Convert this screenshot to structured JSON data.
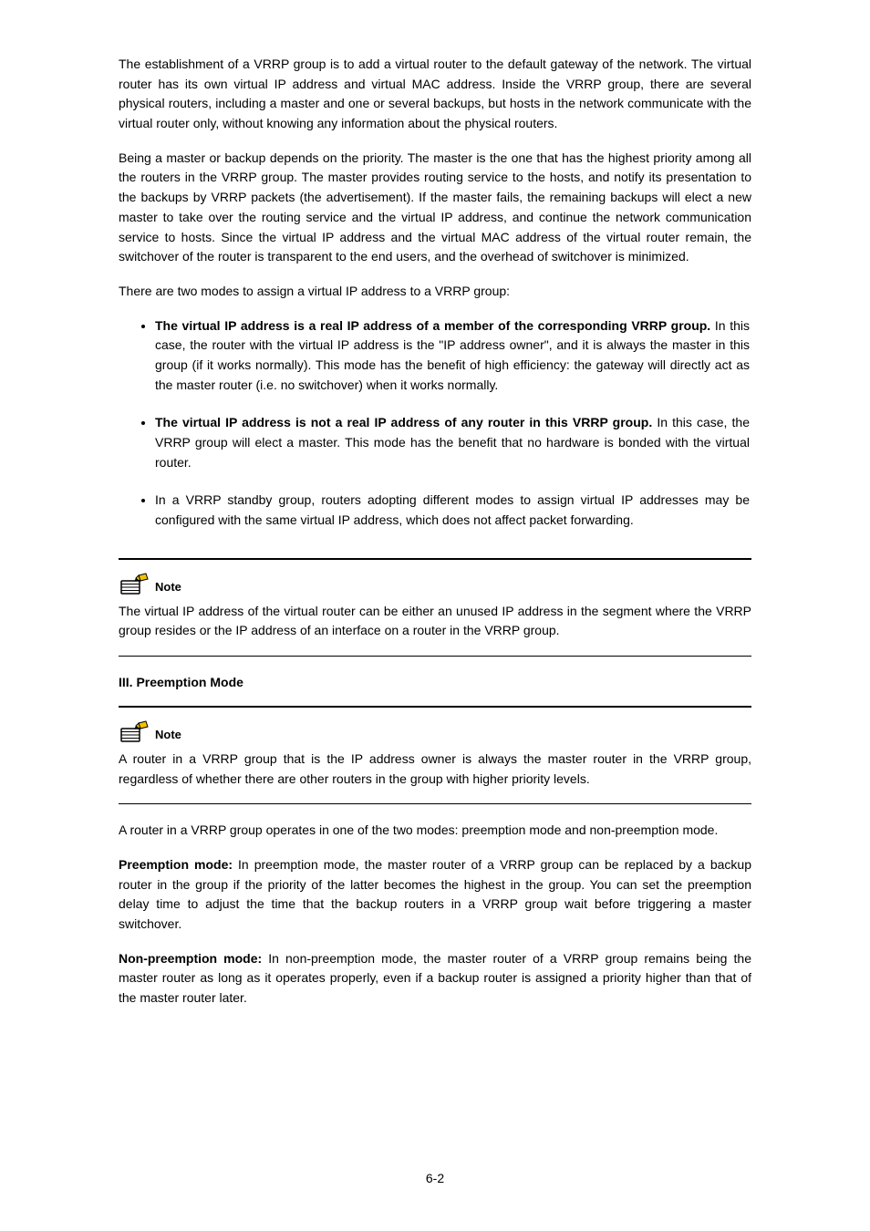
{
  "para1": "The establishment of a VRRP group is to add a virtual router to the default gateway of the network. The virtual router has its own virtual IP address and virtual MAC address. Inside the VRRP group, there are several physical routers, including a master and one or several backups, but hosts in the network communicate with the virtual router only, without knowing any information about the physical routers.",
  "para2": "Being a master or backup depends on the priority. The master is the one that has the highest priority among all the routers in the VRRP group. The master provides routing service to the hosts, and notify its presentation to the backups by VRRP packets (the advertisement). If the master fails, the remaining backups will elect a new master to take over the routing service and the virtual IP address, and continue the network communication service to hosts. Since the virtual IP address and the virtual MAC address of the virtual router remain, the switchover of the router is transparent to the end users, and the overhead of switchover is minimized.",
  "para3_lead": "There are two modes to assign a virtual IP address to a VRRP group: ",
  "bullets": [
    {
      "lead": "The virtual IP address is a real IP address of a member of the corresponding VRRP group.",
      "body": " In this case, the router with the virtual IP address is the \"IP address owner\", and it is always the master in this group (if it works normally). This mode has the benefit of high efficiency: the gateway will directly act as the master router (i.e. no switchover) when it works normally."
    },
    {
      "lead": "The virtual IP address is not a real IP address of any router in this VRRP group.",
      "body": " In this case, the VRRP group will elect a master. This mode has the benefit that no hardware is bonded with the virtual router."
    },
    {
      "lead": "",
      "body": "In a VRRP standby group, routers adopting different modes to assign virtual IP addresses may be configured with the same virtual IP address, which does not affect packet forwarding."
    }
  ],
  "note1": {
    "label": "Note",
    "text": "The virtual IP address of the virtual router can be either an unused IP address in the segment where the VRRP group resides or the IP address of an interface on a router in the VRRP group."
  },
  "heading": "III. Preemption Mode",
  "note2": {
    "label": "Note",
    "text": "A router in a VRRP group that is the IP address owner is always the master router in the VRRP group, regardless of whether there are other routers in the group with higher priority levels."
  },
  "para4": "A router in a VRRP group operates in one of the two modes: preemption mode and non-preemption mode.",
  "para5_label": "Preemption mode: ",
  "para5": "In preemption mode, the master router of a VRRP group can be replaced by a backup router in the group if the priority of the latter becomes the highest in the group. You can set the preemption delay time to adjust the time that the backup routers in a VRRP group wait before triggering a master switchover.",
  "para6_label": "Non-preemption mode: ",
  "para6": "In non-preemption mode, the master router of a VRRP group remains being the master router as long as it operates properly, even if a backup router is assigned a priority higher than that of the master router later.",
  "page_number": "6-2"
}
